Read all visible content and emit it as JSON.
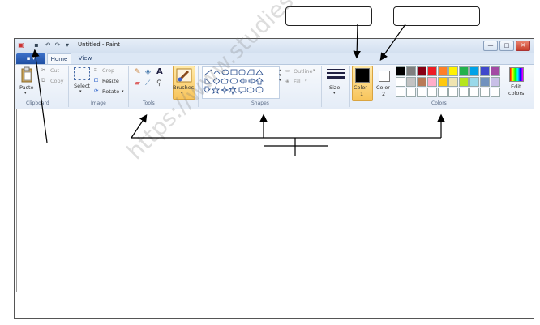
{
  "window": {
    "title": "Untitled - Paint",
    "controls": {
      "minimize": "—",
      "maximize": "□",
      "close": "✕"
    }
  },
  "tabs": {
    "file": "▪ ▾",
    "home": "Home",
    "view": "View"
  },
  "clipboard": {
    "paste": "Paste",
    "cut": "Cut",
    "copy": "Copy",
    "group_label": "Clipboard"
  },
  "image": {
    "select": "Select",
    "crop": "Crop",
    "resize": "Resize",
    "rotate": "Rotate",
    "group_label": "Image"
  },
  "tools": {
    "group_label": "Tools",
    "text_tool": "A"
  },
  "brushes": {
    "label": "Brushes"
  },
  "shapes": {
    "outline": "Outline",
    "fill": "Fill",
    "group_label": "Shapes"
  },
  "size": {
    "label": "Size"
  },
  "color1": {
    "label": "Color",
    "sub": "1",
    "value": "#000000"
  },
  "color2": {
    "label": "Color",
    "sub": "2",
    "value": "#ffffff"
  },
  "colors": {
    "group_label": "Colors",
    "edit": "Edit",
    "edit2": "colors",
    "palette_row1": [
      "#000000",
      "#7f7f7f",
      "#880015",
      "#ed1c24",
      "#ff7f27",
      "#fff200",
      "#22b14c",
      "#00a2e8",
      "#3f48cc",
      "#a349a4"
    ],
    "palette_row2": [
      "#ffffff",
      "#c3c3c3",
      "#b97a57",
      "#ffaec9",
      "#ffc90e",
      "#efe4b0",
      "#b5e61d",
      "#99d9ea",
      "#7092be",
      "#c8bfe7"
    ],
    "palette_row3": [
      "#ffffff",
      "#ffffff",
      "#ffffff",
      "#ffffff",
      "#ffffff",
      "#ffffff",
      "#ffffff",
      "#ffffff",
      "#ffffff",
      "#ffffff"
    ]
  },
  "watermark": "https://www.studiestoday.com"
}
